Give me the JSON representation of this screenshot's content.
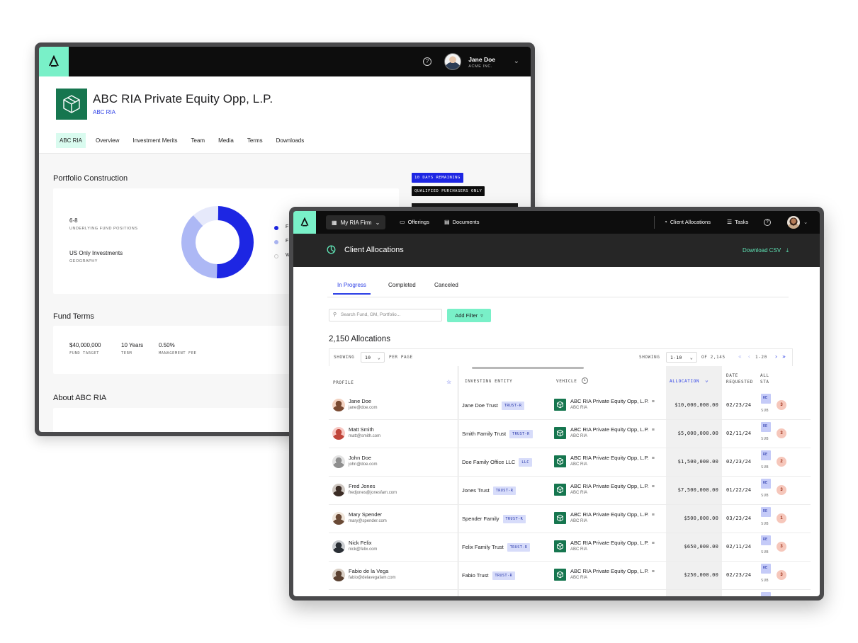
{
  "back_window": {
    "user": {
      "name": "Jane Doe",
      "company": "ACME INC."
    },
    "fund": {
      "title": "ABC RIA Private Equity Opp, L.P.",
      "subtitle": "ABC RIA"
    },
    "tabs": [
      "ABC RIA",
      "Overview",
      "Investment Merits",
      "Team",
      "Media",
      "Terms",
      "Downloads"
    ],
    "portfolio": {
      "title": "Portfolio Construction",
      "stats": [
        {
          "value": "6-8",
          "label": "UNDERLYING FUND POSITIONS"
        },
        {
          "value": "US Only Investments",
          "label": "GEOGRAPHY"
        }
      ],
      "donut_fractions": [
        0.5,
        0.38,
        0.12
      ],
      "legend_initials": [
        "F",
        "F",
        "W"
      ],
      "colors": [
        "#1d26e3",
        "#adb8f5",
        "#e6e9fb"
      ]
    },
    "pills": {
      "days": "10 DAYS REMAINING",
      "qualified": "QUALIFIED PURCHASERS ONLY"
    },
    "fund_terms": {
      "title": "Fund Terms",
      "items": [
        {
          "value": "$40,000,000",
          "label": "FUND TARGET"
        },
        {
          "value": "10 Years",
          "label": "TERM"
        },
        {
          "value": "0.50%",
          "label": "MANAGEMENT FEE"
        }
      ]
    },
    "about_title": "About ABC RIA"
  },
  "front_window": {
    "firm_button": "My RIA Firm",
    "nav": {
      "offerings": "Offerings",
      "documents": "Documents",
      "client_allocations": "Client Allocations",
      "tasks": "Tasks"
    },
    "page_title": "Client Allocations",
    "download_csv": "Download CSV",
    "tabs": {
      "in_progress": "In Progress",
      "completed": "Completed",
      "canceled": "Canceled"
    },
    "search_placeholder": "Search Fund, GM, Portfolio...",
    "add_filter": "Add Filter",
    "count_label": "2,150 Allocations",
    "pager": {
      "showing_label": "SHOWING",
      "per_page_value": "10",
      "per_page_label": "PER PAGE",
      "showing_label_2": "SHOWING",
      "range_value": "1-10",
      "of_total": "OF 2,145",
      "page_range": "1-20"
    },
    "columns": {
      "profile": "PROFILE",
      "investing_entity": "INVESTING ENTITY",
      "vehicle": "VEHICLE",
      "allocation": "ALLOCATION",
      "date_requested_1": "DATE",
      "date_requested_2": "REQUESTED",
      "status_1": "ALL",
      "status_2": "STA"
    },
    "rows": [
      {
        "name": "Jane Doe",
        "email": "jane@doe.com",
        "entity": "Jane Doe Trust",
        "entity_tag": "TRUST-R",
        "vehicle": "ABC RIA Private Equity Opp, L.P.",
        "vehicle_sub": "ABC RIA",
        "allocation": "$10,000,000.00",
        "date": "02/23/24",
        "status_tag": "RE",
        "status_sub": "SUB",
        "badge": "3"
      },
      {
        "name": "Matt Smith",
        "email": "matt@smith.com",
        "entity": "Smith Family Trust",
        "entity_tag": "TRUST-R",
        "vehicle": "ABC RIA Private Equity Opp, L.P.",
        "vehicle_sub": "ABC RIA",
        "allocation": "$5,000,000.00",
        "date": "02/11/24",
        "status_tag": "RE",
        "status_sub": "SUB",
        "badge": "3"
      },
      {
        "name": "John Doe",
        "email": "john@doe.com",
        "entity": "Doe Family Office LLC",
        "entity_tag": "LLC",
        "vehicle": "ABC RIA Private Equity Opp, L.P.",
        "vehicle_sub": "ABC RIA",
        "allocation": "$1,500,000.00",
        "date": "02/23/24",
        "status_tag": "RE",
        "status_sub": "SUB",
        "badge": "2"
      },
      {
        "name": "Fred Jones",
        "email": "fredjones@jonesfam.com",
        "entity": "Jones Trust",
        "entity_tag": "TRUST-R",
        "vehicle": "ABC RIA Private Equity Opp, L.P.",
        "vehicle_sub": "ABC RIA",
        "allocation": "$7,500,000.00",
        "date": "01/22/24",
        "status_tag": "RE",
        "status_sub": "SUB",
        "badge": "3"
      },
      {
        "name": "Mary Spender",
        "email": "mary@spender.com",
        "entity": "Spender Family",
        "entity_tag": "TRUST-R",
        "vehicle": "ABC RIA Private Equity Opp, L.P.",
        "vehicle_sub": "ABC RIA",
        "allocation": "$500,000.00",
        "date": "03/23/24",
        "status_tag": "RE",
        "status_sub": "SUB",
        "badge": "1"
      },
      {
        "name": "Nick Felix",
        "email": "nick@felix.com",
        "entity": "Felix Family Trust",
        "entity_tag": "TRUST-R",
        "vehicle": "ABC RIA Private Equity Opp, L.P.",
        "vehicle_sub": "ABC RIA",
        "allocation": "$650,000.00",
        "date": "02/11/24",
        "status_tag": "RE",
        "status_sub": "SUB",
        "badge": "3"
      },
      {
        "name": "Fabio de la Vega",
        "email": "fabio@delavegafam.com",
        "entity": "Fabio Trust",
        "entity_tag": "TRUST-R",
        "vehicle": "ABC RIA Private Equity Opp, L.P.",
        "vehicle_sub": "ABC RIA",
        "allocation": "$250,000.00",
        "date": "02/23/24",
        "status_tag": "RE",
        "status_sub": "SUB",
        "badge": "3"
      }
    ],
    "accent": "#79f0c8",
    "brand_blue": "#2b3ee6"
  }
}
